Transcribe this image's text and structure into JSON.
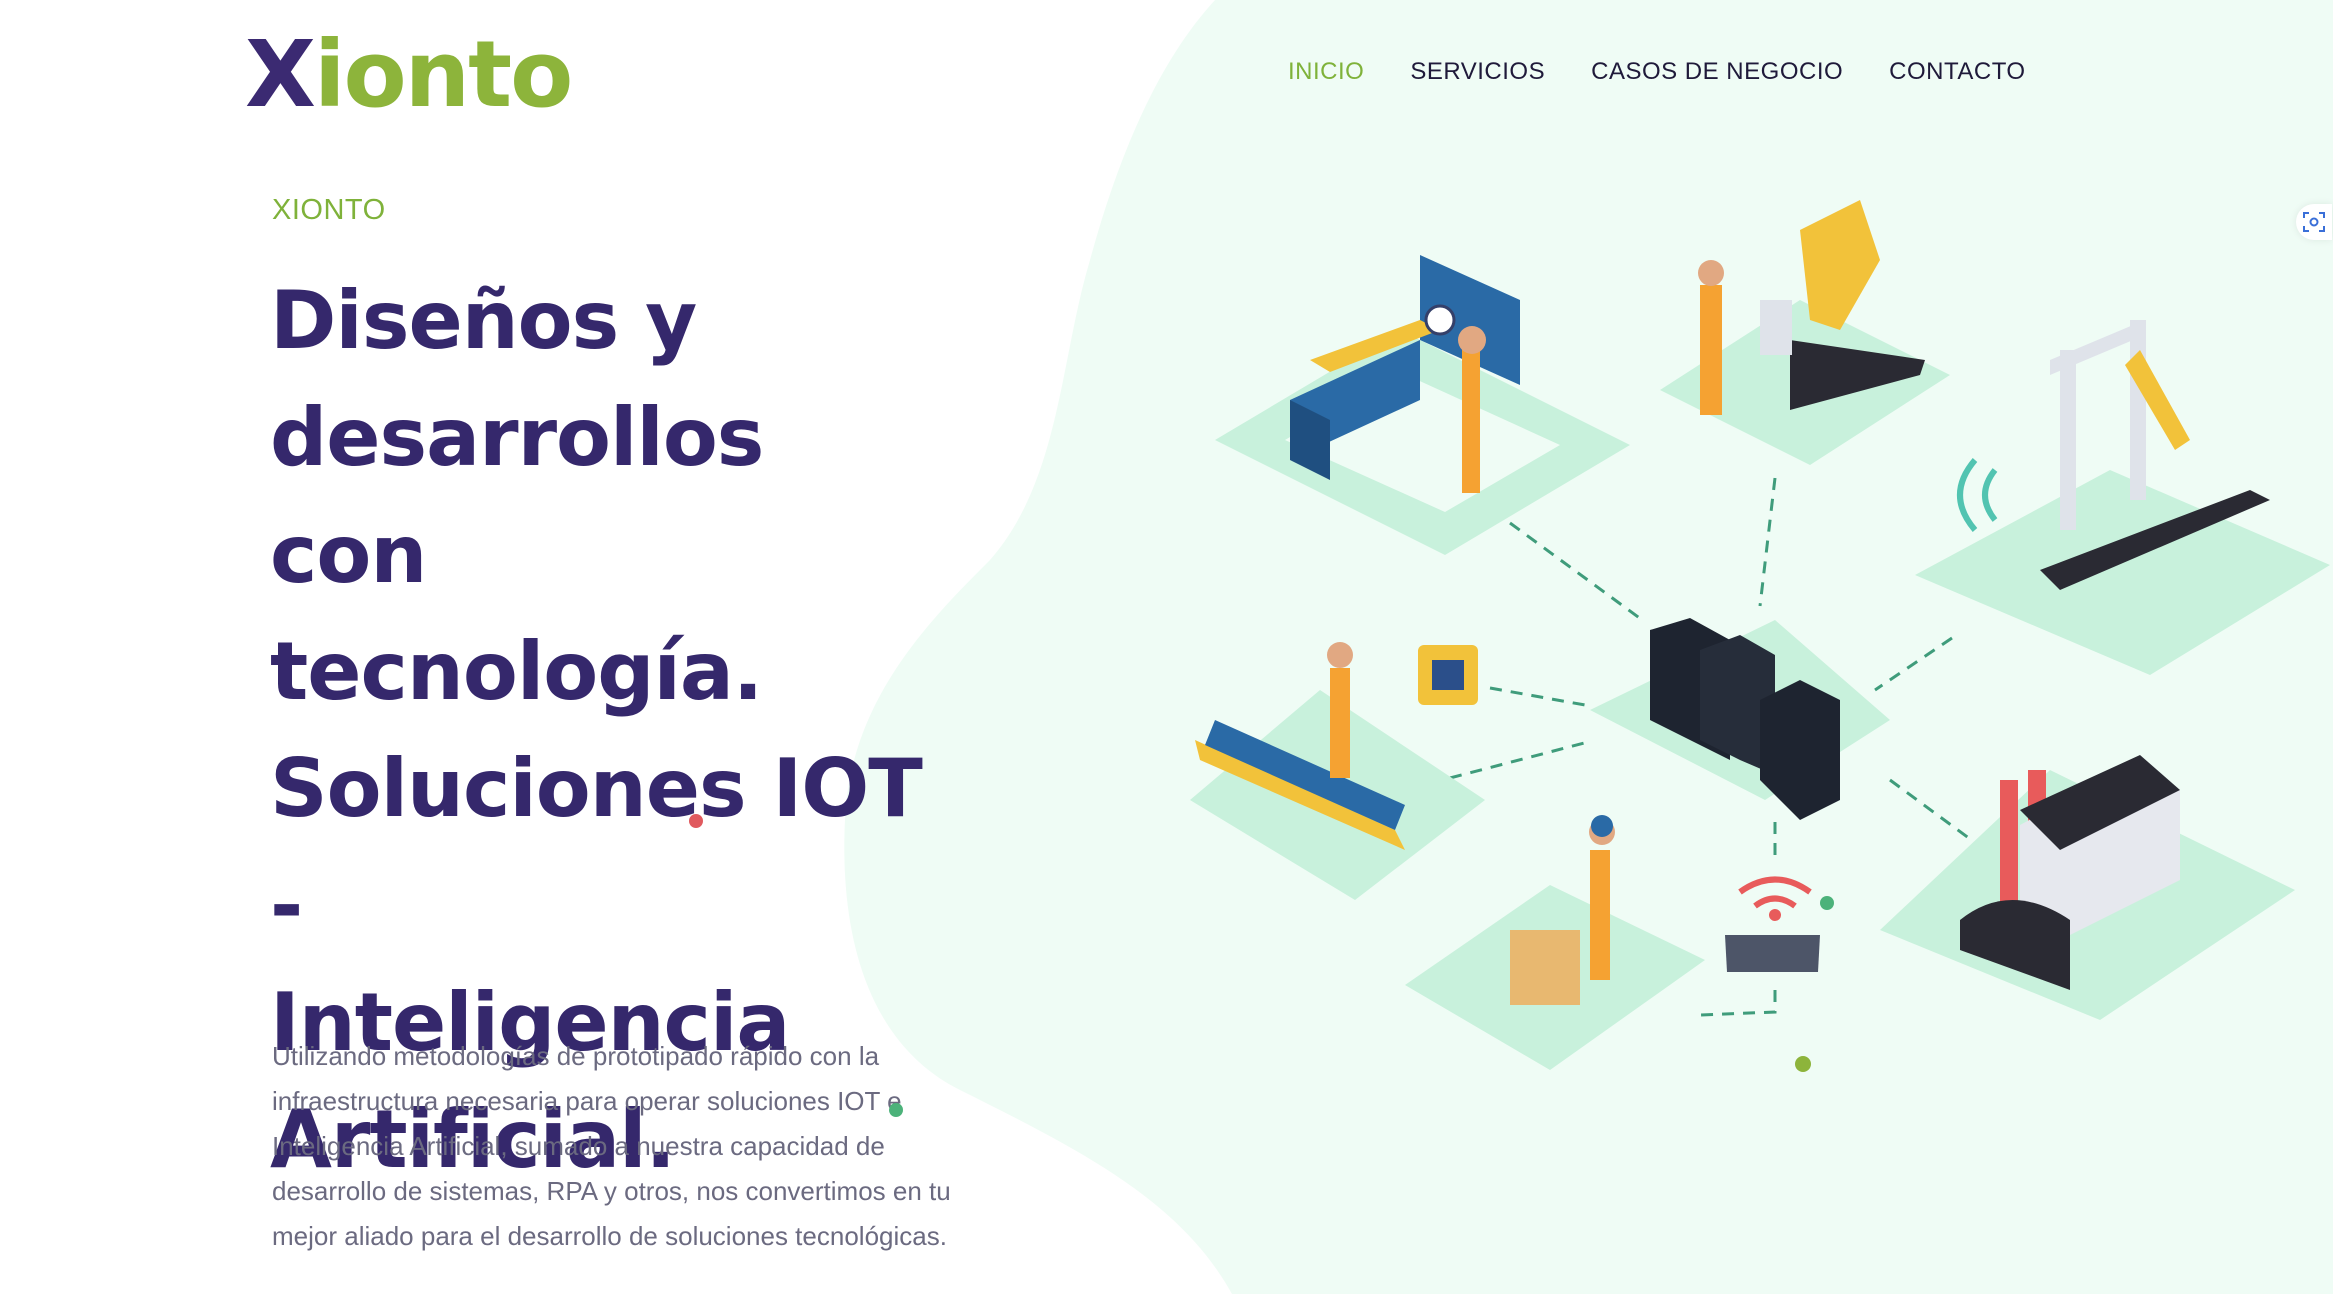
{
  "brand": {
    "logo_x": "X",
    "logo_rest": "ionto",
    "colors": {
      "primary": "#35286c",
      "accent_green": "#7fb23a",
      "mint_bg": "#eefbf4",
      "tile": "#c8f1dc"
    }
  },
  "nav": {
    "items": [
      {
        "label": "INICIO",
        "active": true
      },
      {
        "label": "SERVICIOS",
        "active": false
      },
      {
        "label": "CASOS DE NEGOCIO",
        "active": false
      },
      {
        "label": "CONTACTO",
        "active": false
      }
    ]
  },
  "hero": {
    "eyebrow": "XIONTO",
    "headline_lines": [
      "Diseños y",
      "desarrollos con",
      "tecnología.",
      "Soluciones IOT -",
      "Inteligencia",
      "Artificial."
    ],
    "intro_lines": [
      "Utilizando metodologías de prototipado rápido con la",
      "infraestructura necesaria para operar soluciones IOT e",
      "Inteligencia Artificial, sumado a nuestra capacidad de",
      "desarrollo de sistemas, RPA y otros, nos convertimos en tu",
      "mejor aliado para el desarrollo de soluciones tecnológicas."
    ]
  },
  "illustration": {
    "icons": [
      "cnc-machine-icon",
      "robotic-arm-icon",
      "conveyor-robot-icon",
      "server-rack-icon",
      "microchip-icon",
      "conveyor-worker-icon",
      "delivery-worker-icon",
      "wifi-router-icon",
      "factory-icon"
    ]
  },
  "widgets": {
    "scan_icon": "scan-icon"
  }
}
